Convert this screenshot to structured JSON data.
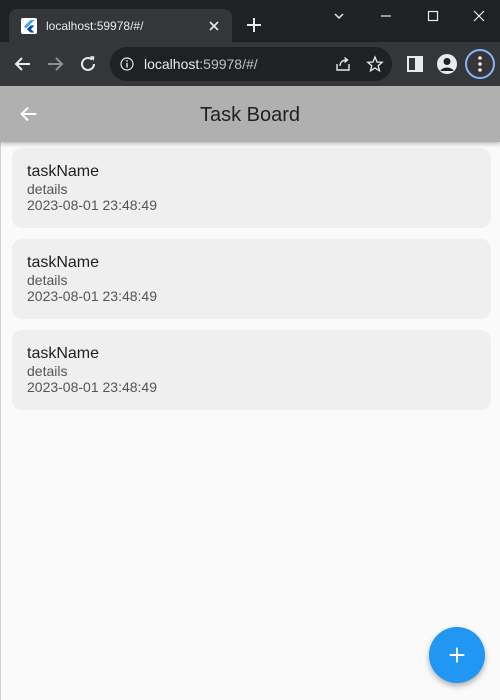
{
  "browser": {
    "tab_title": "localhost:59978/#/",
    "url_host": "localhost",
    "url_rest": ":59978/#/"
  },
  "app": {
    "title": "Task Board"
  },
  "tasks": [
    {
      "name": "taskName",
      "details": "details",
      "date": "2023-08-01 23:48:49"
    },
    {
      "name": "taskName",
      "details": "details",
      "date": "2023-08-01 23:48:49"
    },
    {
      "name": "taskName",
      "details": "details",
      "date": "2023-08-01 23:48:49"
    }
  ],
  "colors": {
    "app_bar": "#b0b0b0",
    "fab": "#2196f3",
    "card": "#efefef"
  }
}
